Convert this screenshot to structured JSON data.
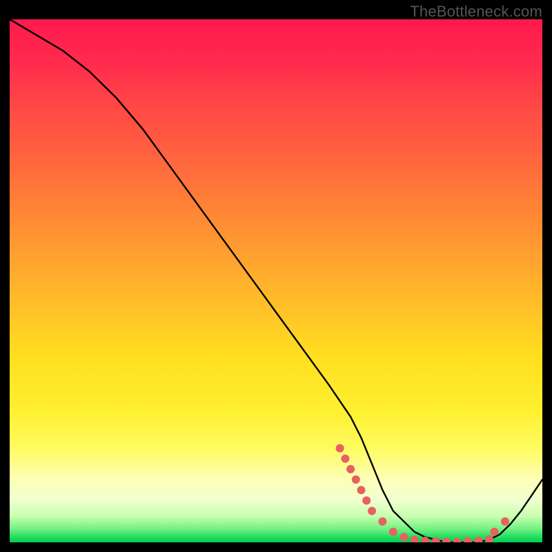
{
  "watermark": "TheBottleneck.com",
  "colors": {
    "background": "#000000",
    "curve": "#000000",
    "dots": "#e86060"
  },
  "chart_data": {
    "type": "line",
    "title": "",
    "xlabel": "",
    "ylabel": "",
    "xlim": [
      0,
      100
    ],
    "ylim": [
      0,
      100
    ],
    "grid": false,
    "series": [
      {
        "name": "curve",
        "x": [
          0,
          5,
          10,
          15,
          20,
          25,
          30,
          35,
          40,
          45,
          50,
          55,
          60,
          62,
          64,
          66,
          68,
          70,
          72,
          74,
          76,
          78,
          80,
          82,
          84,
          86,
          88,
          90,
          92,
          94,
          96,
          98,
          100
        ],
        "values": [
          100,
          97,
          94,
          90,
          85,
          79,
          72,
          65,
          58,
          51,
          44,
          37,
          30,
          27,
          24,
          20,
          15,
          10,
          6,
          4,
          2,
          1,
          0.5,
          0,
          0,
          0,
          0,
          0.5,
          1.5,
          3.5,
          6,
          9,
          12
        ]
      }
    ],
    "markers": [
      {
        "name": "highlighted-points",
        "style": "dot",
        "x": [
          62,
          63,
          64,
          65,
          66,
          67,
          68,
          70,
          72,
          74,
          76,
          78,
          80,
          82,
          84,
          86,
          88,
          90,
          91,
          93
        ],
        "values": [
          18,
          16,
          14,
          12,
          10,
          8,
          6,
          4,
          2,
          1,
          0.5,
          0.3,
          0.2,
          0.1,
          0.1,
          0.2,
          0.3,
          0.6,
          2,
          4
        ]
      }
    ]
  }
}
